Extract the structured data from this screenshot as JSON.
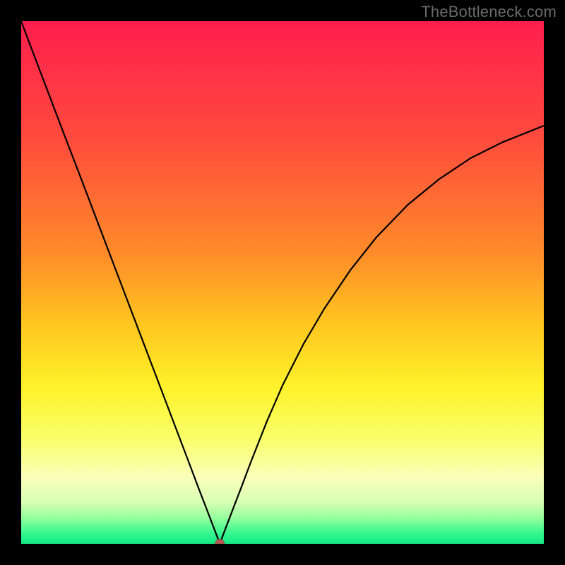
{
  "watermark": "TheBottleneck.com",
  "colors": {
    "frame": "#000000",
    "curve": "#000000",
    "dot_fill": "#b05a52",
    "dot_stroke": "#8e423b",
    "gradient_stops": [
      {
        "pct": 0,
        "color": "#ff1e4e"
      },
      {
        "pct": 22,
        "color": "#ff4a3d"
      },
      {
        "pct": 44,
        "color": "#ff8a2a"
      },
      {
        "pct": 58,
        "color": "#ffc61f"
      },
      {
        "pct": 70,
        "color": "#fff22a"
      },
      {
        "pct": 80,
        "color": "#f8ff6a"
      },
      {
        "pct": 87,
        "color": "#fbffb8"
      },
      {
        "pct": 92,
        "color": "#d9ffb4"
      },
      {
        "pct": 95,
        "color": "#97ff9e"
      },
      {
        "pct": 98,
        "color": "#35f78f"
      },
      {
        "pct": 100,
        "color": "#13e884"
      }
    ]
  },
  "chart_data": {
    "type": "line",
    "title": "",
    "xlabel": "",
    "ylabel": "",
    "xlim": [
      0,
      100
    ],
    "ylim": [
      0,
      100
    ],
    "grid": false,
    "legend": false,
    "annotations": [],
    "min_point": {
      "x": 38,
      "y": 0
    },
    "x": [
      0,
      2,
      5,
      8,
      11,
      14,
      17,
      20,
      23,
      26,
      29,
      32,
      34,
      35.5,
      36.8,
      37.6,
      38,
      38.4,
      39.2,
      40.5,
      42,
      44,
      47,
      50,
      54,
      58,
      63,
      68,
      74,
      80,
      86,
      92,
      100
    ],
    "y": [
      100,
      94.7,
      86.8,
      78.9,
      71.1,
      63.2,
      55.3,
      47.4,
      39.5,
      31.6,
      23.7,
      15.8,
      10.5,
      6.6,
      3.2,
      1.1,
      0.0,
      1.1,
      3.2,
      6.6,
      10.5,
      15.8,
      23.4,
      30.3,
      38.2,
      45.0,
      52.4,
      58.7,
      64.9,
      69.8,
      73.8,
      76.8,
      80.0
    ]
  }
}
